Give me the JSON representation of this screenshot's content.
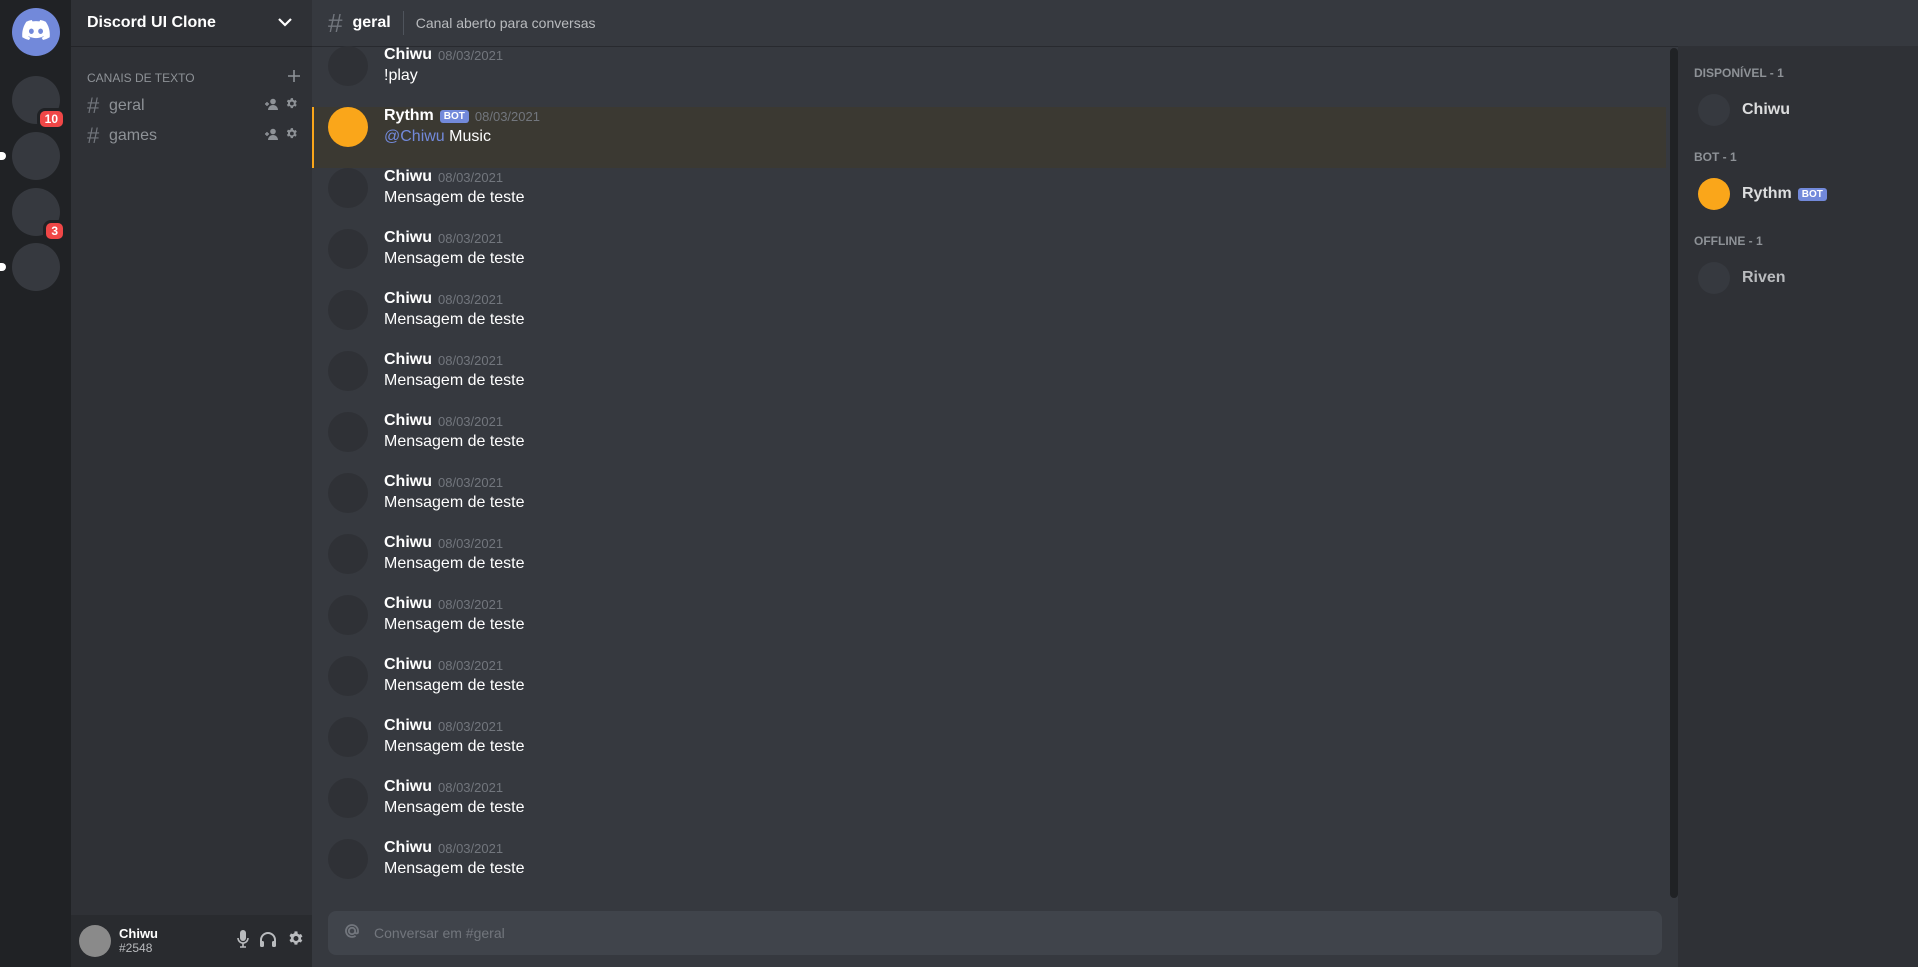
{
  "colors": {
    "brand": "#7289da",
    "bot_avatar": "#faa61a",
    "badge": "#f04747",
    "mention": "#7289da"
  },
  "servers": {
    "home_icon": "discord-logo-icon",
    "items": [
      {
        "badge": "10"
      },
      {
        "badge": ""
      },
      {
        "badge": "3"
      },
      {
        "badge": ""
      }
    ]
  },
  "sidebar": {
    "server_name": "Discord UI Clone",
    "category": "Canais de texto",
    "channels": [
      {
        "name": "geral"
      },
      {
        "name": "games"
      }
    ]
  },
  "user": {
    "name": "Chiwu",
    "tag": "#2548"
  },
  "header": {
    "hash": "#",
    "channel": "geral",
    "topic": "Canal aberto para conversas"
  },
  "messages": [
    {
      "author": "Chiwu",
      "date": "08/03/2021",
      "text": "!play"
    },
    {
      "author": "Rythm",
      "bot_tag": "BOT",
      "date": "08/03/2021",
      "mention": "@Chiwu",
      "text": "Music"
    },
    {
      "author": "Chiwu",
      "date": "08/03/2021",
      "text": "Mensagem de teste"
    },
    {
      "author": "Chiwu",
      "date": "08/03/2021",
      "text": "Mensagem de teste"
    },
    {
      "author": "Chiwu",
      "date": "08/03/2021",
      "text": "Mensagem de teste"
    },
    {
      "author": "Chiwu",
      "date": "08/03/2021",
      "text": "Mensagem de teste"
    },
    {
      "author": "Chiwu",
      "date": "08/03/2021",
      "text": "Mensagem de teste"
    },
    {
      "author": "Chiwu",
      "date": "08/03/2021",
      "text": "Mensagem de teste"
    },
    {
      "author": "Chiwu",
      "date": "08/03/2021",
      "text": "Mensagem de teste"
    },
    {
      "author": "Chiwu",
      "date": "08/03/2021",
      "text": "Mensagem de teste"
    },
    {
      "author": "Chiwu",
      "date": "08/03/2021",
      "text": "Mensagem de teste"
    },
    {
      "author": "Chiwu",
      "date": "08/03/2021",
      "text": "Mensagem de teste"
    },
    {
      "author": "Chiwu",
      "date": "08/03/2021",
      "text": "Mensagem de teste"
    },
    {
      "author": "Chiwu",
      "date": "08/03/2021",
      "text": "Mensagem de teste"
    }
  ],
  "input": {
    "placeholder": "Conversar em #geral"
  },
  "members": {
    "groups": [
      {
        "title": "Disponível - 1",
        "members": [
          {
            "name": "Chiwu"
          }
        ]
      },
      {
        "title": "Bot - 1",
        "members": [
          {
            "name": "Rythm",
            "bot_tag": "BOT"
          }
        ]
      },
      {
        "title": "Offline - 1",
        "members": [
          {
            "name": "Riven"
          }
        ]
      }
    ]
  }
}
